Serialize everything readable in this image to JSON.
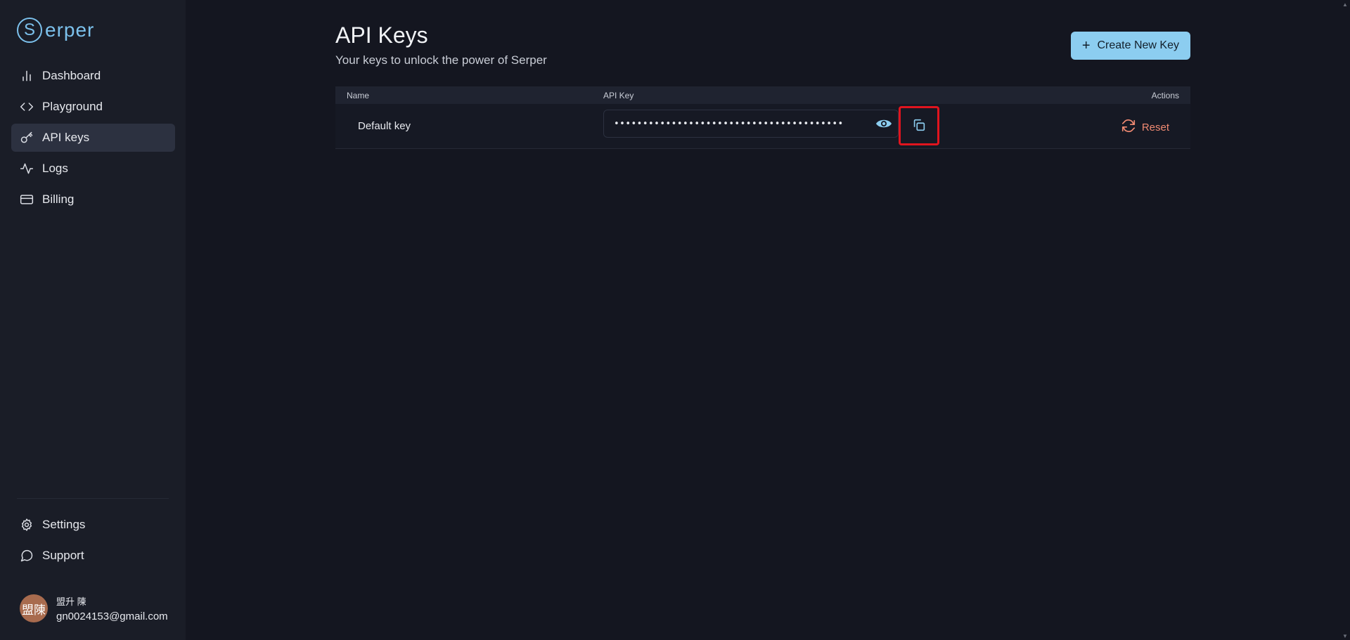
{
  "brand": {
    "logo_letter": "S",
    "logo_text": "erper",
    "accent_color": "#7cc1ec"
  },
  "sidebar": {
    "items": [
      {
        "label": "Dashboard",
        "icon": "bar-chart-icon"
      },
      {
        "label": "Playground",
        "icon": "code-icon"
      },
      {
        "label": "API keys",
        "icon": "key-icon",
        "active": true
      },
      {
        "label": "Logs",
        "icon": "activity-icon"
      },
      {
        "label": "Billing",
        "icon": "credit-card-icon"
      }
    ],
    "bottom_items": [
      {
        "label": "Settings",
        "icon": "gear-icon"
      },
      {
        "label": "Support",
        "icon": "chat-bubble-icon"
      }
    ],
    "user": {
      "avatar_text": "盟陳",
      "name": "盟升 陳",
      "email": "gn0024153@gmail.com"
    }
  },
  "main": {
    "title": "API Keys",
    "subtitle": "Your keys to unlock the power of Serper",
    "create_button_label": "Create New Key",
    "table": {
      "headers": {
        "name": "Name",
        "key": "API Key",
        "actions": "Actions"
      },
      "rows": [
        {
          "name": "Default key",
          "masked_key": "••••••••••••••••••••••••••••••••••••••••",
          "action_label": "Reset"
        }
      ]
    }
  }
}
